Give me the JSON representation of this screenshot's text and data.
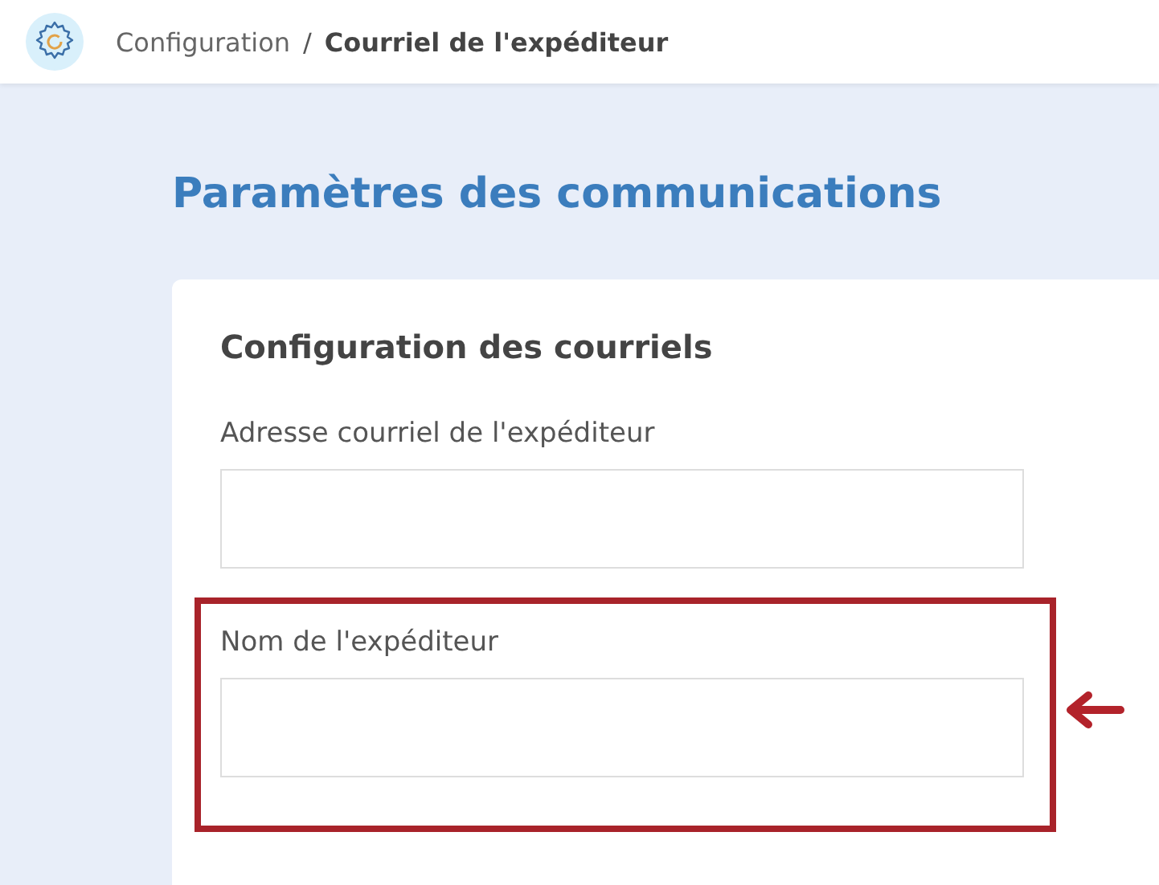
{
  "breadcrumb": [
    {
      "label": "Configuration",
      "current": false
    },
    {
      "label": "Courriel de l'expéditeur",
      "current": true
    }
  ],
  "breadcrumb_separator": "/",
  "page_title": "Paramètres des communications",
  "card": {
    "title": "Configuration des courriels",
    "fields": [
      {
        "label": "Adresse courriel de l'expéditeur",
        "highlighted": false
      },
      {
        "label": "Nom de l'expéditeur",
        "highlighted": true
      }
    ]
  }
}
